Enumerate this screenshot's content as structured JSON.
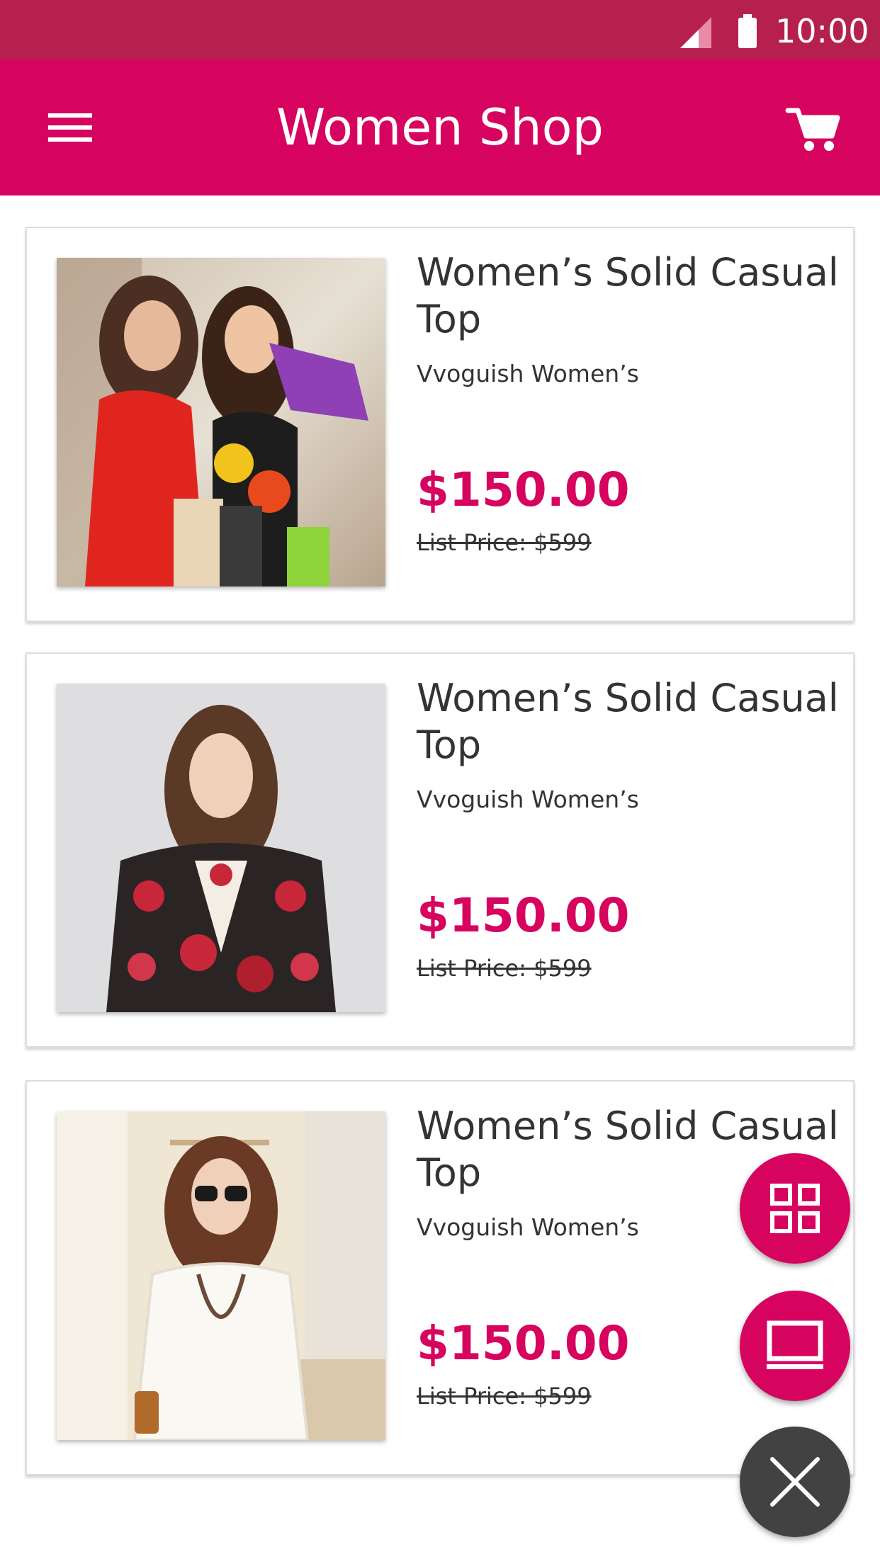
{
  "status_bar": {
    "time": "10:00"
  },
  "app_bar": {
    "title": "Women Shop"
  },
  "products": [
    {
      "title": "Women’s Solid Casual Top",
      "brand": "Vvoguish Women’s",
      "price": "$150.00",
      "list_price": "List Price: $599"
    },
    {
      "title": "Women’s Solid Casual Top",
      "brand": "Vvoguish Women’s",
      "price": "$150.00",
      "list_price": "List Price: $599"
    },
    {
      "title": "Women’s Solid Casual Top",
      "brand": "Vvoguish Women’s",
      "price": "$150.00",
      "list_price": "List Price: $599"
    }
  ],
  "icons": {
    "menu": "menu-icon",
    "cart": "cart-icon",
    "grid": "grid-view-icon",
    "view": "laptop-view-icon",
    "close": "close-icon"
  },
  "colors": {
    "status_bar": "#b5204f",
    "primary": "#d6045f",
    "fab_close": "#424242",
    "text": "#333333"
  }
}
